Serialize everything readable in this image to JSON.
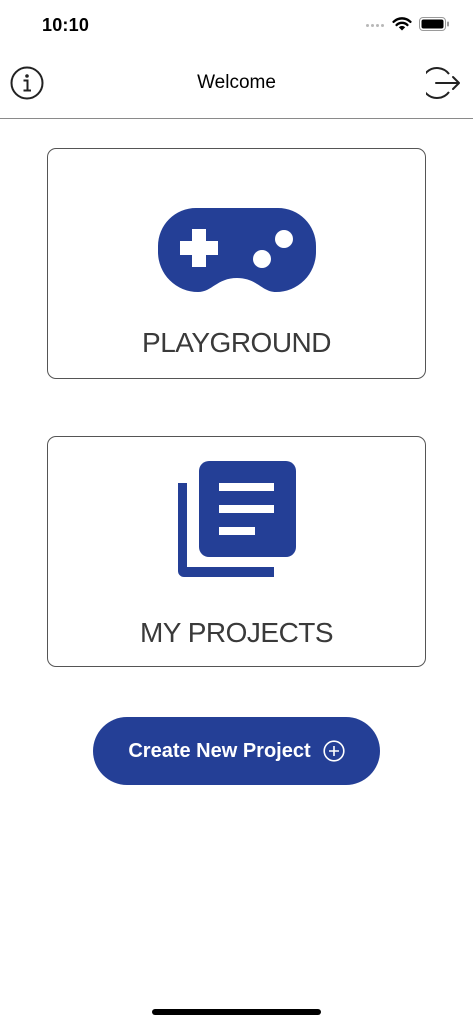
{
  "status_bar": {
    "time": "10:10"
  },
  "nav": {
    "title": "Welcome",
    "info_icon": "info-circle-icon",
    "logout_icon": "logout-icon"
  },
  "cards": {
    "playground": {
      "label": "PLAYGROUND",
      "icon": "gamepad-icon"
    },
    "projects": {
      "label": "MY PROJECTS",
      "icon": "documents-icon"
    }
  },
  "create_button": {
    "label": "Create New Project",
    "icon": "plus-circle-icon"
  },
  "colors": {
    "accent": "#243f96",
    "background": "#ffffff"
  }
}
